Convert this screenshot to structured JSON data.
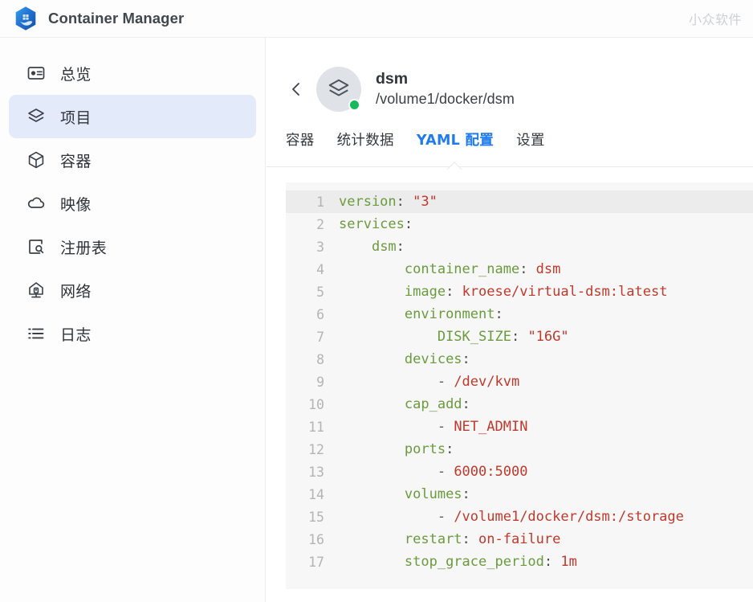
{
  "app": {
    "title": "Container Manager",
    "logo_icon": "container-manager-logo",
    "watermark": "小众软件"
  },
  "sidebar": {
    "items": [
      {
        "label": "总览",
        "icon": "dashboard-icon",
        "active": false
      },
      {
        "label": "项目",
        "icon": "layers-icon",
        "active": true
      },
      {
        "label": "容器",
        "icon": "cube-icon",
        "active": false
      },
      {
        "label": "映像",
        "icon": "cloud-icon",
        "active": false
      },
      {
        "label": "注册表",
        "icon": "registry-search-icon",
        "active": false
      },
      {
        "label": "网络",
        "icon": "network-hub-icon",
        "active": false
      },
      {
        "label": "日志",
        "icon": "list-icon",
        "active": false
      }
    ]
  },
  "detail": {
    "back_icon": "chevron-left-icon",
    "avatar_icon": "layers-icon",
    "status": "running",
    "status_color": "#16b95b",
    "name": "dsm",
    "path": "/volume1/docker/dsm"
  },
  "tabs": [
    {
      "label": "容器",
      "active": false
    },
    {
      "label": "统计数据",
      "active": false
    },
    {
      "label": "YAML 配置",
      "active": true
    },
    {
      "label": "设置",
      "active": false
    }
  ],
  "accent_color": "#1e7bf0",
  "yaml": {
    "highlighted_line": 1,
    "lines": [
      {
        "n": "1",
        "tokens": [
          {
            "t": "version",
            "c": "key"
          },
          {
            "t": ": ",
            "c": "punct"
          },
          {
            "t": "\"3\"",
            "c": "val"
          }
        ]
      },
      {
        "n": "2",
        "tokens": [
          {
            "t": "services",
            "c": "key"
          },
          {
            "t": ":",
            "c": "punct"
          }
        ]
      },
      {
        "n": "3",
        "tokens": [
          {
            "t": "    ",
            "c": "plain"
          },
          {
            "t": "dsm",
            "c": "key"
          },
          {
            "t": ":",
            "c": "punct"
          }
        ]
      },
      {
        "n": "4",
        "tokens": [
          {
            "t": "        ",
            "c": "plain"
          },
          {
            "t": "container_name",
            "c": "key"
          },
          {
            "t": ": ",
            "c": "punct"
          },
          {
            "t": "dsm",
            "c": "val"
          }
        ]
      },
      {
        "n": "5",
        "tokens": [
          {
            "t": "        ",
            "c": "plain"
          },
          {
            "t": "image",
            "c": "key"
          },
          {
            "t": ": ",
            "c": "punct"
          },
          {
            "t": "kroese/virtual-dsm:latest",
            "c": "val"
          }
        ]
      },
      {
        "n": "6",
        "tokens": [
          {
            "t": "        ",
            "c": "plain"
          },
          {
            "t": "environment",
            "c": "key"
          },
          {
            "t": ":",
            "c": "punct"
          }
        ]
      },
      {
        "n": "7",
        "tokens": [
          {
            "t": "            ",
            "c": "plain"
          },
          {
            "t": "DISK_SIZE",
            "c": "key"
          },
          {
            "t": ": ",
            "c": "punct"
          },
          {
            "t": "\"16G\"",
            "c": "val"
          }
        ]
      },
      {
        "n": "8",
        "tokens": [
          {
            "t": "        ",
            "c": "plain"
          },
          {
            "t": "devices",
            "c": "key"
          },
          {
            "t": ":",
            "c": "punct"
          }
        ]
      },
      {
        "n": "9",
        "tokens": [
          {
            "t": "            ",
            "c": "plain"
          },
          {
            "t": "- ",
            "c": "dash"
          },
          {
            "t": "/dev/kvm",
            "c": "val"
          }
        ]
      },
      {
        "n": "10",
        "tokens": [
          {
            "t": "        ",
            "c": "plain"
          },
          {
            "t": "cap_add",
            "c": "key"
          },
          {
            "t": ":",
            "c": "punct"
          }
        ]
      },
      {
        "n": "11",
        "tokens": [
          {
            "t": "            ",
            "c": "plain"
          },
          {
            "t": "- ",
            "c": "dash"
          },
          {
            "t": "NET_ADMIN",
            "c": "val"
          }
        ]
      },
      {
        "n": "12",
        "tokens": [
          {
            "t": "        ",
            "c": "plain"
          },
          {
            "t": "ports",
            "c": "key"
          },
          {
            "t": ":",
            "c": "punct"
          }
        ]
      },
      {
        "n": "13",
        "tokens": [
          {
            "t": "            ",
            "c": "plain"
          },
          {
            "t": "- ",
            "c": "dash"
          },
          {
            "t": "6000:5000",
            "c": "val"
          }
        ]
      },
      {
        "n": "14",
        "tokens": [
          {
            "t": "        ",
            "c": "plain"
          },
          {
            "t": "volumes",
            "c": "key"
          },
          {
            "t": ":",
            "c": "punct"
          }
        ]
      },
      {
        "n": "15",
        "tokens": [
          {
            "t": "            ",
            "c": "plain"
          },
          {
            "t": "- ",
            "c": "dash"
          },
          {
            "t": "/volume1/docker/dsm:/storage",
            "c": "val"
          }
        ]
      },
      {
        "n": "16",
        "tokens": [
          {
            "t": "        ",
            "c": "plain"
          },
          {
            "t": "restart",
            "c": "key"
          },
          {
            "t": ": ",
            "c": "punct"
          },
          {
            "t": "on-failure",
            "c": "val"
          }
        ]
      },
      {
        "n": "17",
        "tokens": [
          {
            "t": "        ",
            "c": "plain"
          },
          {
            "t": "stop_grace_period",
            "c": "key"
          },
          {
            "t": ": ",
            "c": "punct"
          },
          {
            "t": "1m",
            "c": "val"
          }
        ]
      }
    ]
  }
}
